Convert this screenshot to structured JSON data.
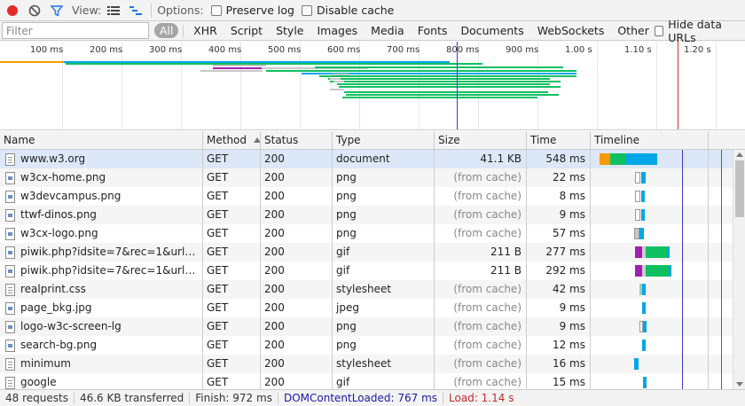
{
  "toolbar": {
    "view_label": "View:",
    "options_label": "Options:",
    "preserve_log_label": "Preserve log",
    "disable_cache_label": "Disable cache"
  },
  "filterbar": {
    "placeholder": "Filter",
    "all_label": "All",
    "types": [
      "XHR",
      "Script",
      "Style",
      "Images",
      "Media",
      "Fonts",
      "Documents",
      "WebSockets",
      "Other"
    ],
    "hide_data_urls_label": "Hide data URLs"
  },
  "overview": {
    "ticks": [
      "100 ms",
      "200 ms",
      "300 ms",
      "400 ms",
      "500 ms",
      "600 ms",
      "700 ms",
      "800 ms",
      "900 ms",
      "1.00 s",
      "1.10 s",
      "1.20 s"
    ]
  },
  "table": {
    "headers": {
      "name": "Name",
      "method": "Method",
      "status": "Status",
      "type": "Type",
      "size": "Size",
      "time": "Time",
      "timeline": "Timeline"
    },
    "rows": [
      {
        "name": "www.w3.org",
        "icon": "doc",
        "method": "GET",
        "status": "200",
        "type": "document",
        "size": "41.1 KB",
        "time": "548 ms",
        "cached": false
      },
      {
        "name": "w3cx-home.png",
        "icon": "img",
        "method": "GET",
        "status": "200",
        "type": "png",
        "size": "(from cache)",
        "time": "22 ms",
        "cached": true
      },
      {
        "name": "w3devcampus.png",
        "icon": "img",
        "method": "GET",
        "status": "200",
        "type": "png",
        "size": "(from cache)",
        "time": "8 ms",
        "cached": true
      },
      {
        "name": "ttwf-dinos.png",
        "icon": "img",
        "method": "GET",
        "status": "200",
        "type": "png",
        "size": "(from cache)",
        "time": "9 ms",
        "cached": true
      },
      {
        "name": "w3cx-logo.png",
        "icon": "img",
        "method": "GET",
        "status": "200",
        "type": "png",
        "size": "(from cache)",
        "time": "57 ms",
        "cached": true
      },
      {
        "name": "piwik.php?idsite=7&rec=1&url=http%...",
        "icon": "img",
        "method": "GET",
        "status": "200",
        "type": "gif",
        "size": "211 B",
        "time": "277 ms",
        "cached": false
      },
      {
        "name": "piwik.php?idsite=7&rec=1&url=http%...",
        "icon": "img",
        "method": "GET",
        "status": "200",
        "type": "gif",
        "size": "211 B",
        "time": "292 ms",
        "cached": false
      },
      {
        "name": "realprint.css",
        "icon": "doc",
        "method": "GET",
        "status": "200",
        "type": "stylesheet",
        "size": "(from cache)",
        "time": "42 ms",
        "cached": true
      },
      {
        "name": "page_bkg.jpg",
        "icon": "img",
        "method": "GET",
        "status": "200",
        "type": "jpeg",
        "size": "(from cache)",
        "time": "9 ms",
        "cached": true
      },
      {
        "name": "logo-w3c-screen-lg",
        "icon": "img",
        "method": "GET",
        "status": "200",
        "type": "png",
        "size": "(from cache)",
        "time": "9 ms",
        "cached": true
      },
      {
        "name": "search-bg.png",
        "icon": "img",
        "method": "GET",
        "status": "200",
        "type": "png",
        "size": "(from cache)",
        "time": "12 ms",
        "cached": true
      },
      {
        "name": "minimum",
        "icon": "doc",
        "method": "GET",
        "status": "200",
        "type": "stylesheet",
        "size": "(from cache)",
        "time": "16 ms",
        "cached": true
      },
      {
        "name": "google",
        "icon": "doc",
        "method": "GET",
        "status": "200",
        "type": "gif",
        "size": "(from cache)",
        "time": "15 ms",
        "cached": true
      }
    ]
  },
  "statusbar": {
    "requests": "48 requests",
    "transferred": "46.6 KB transferred",
    "finish": "Finish: 972 ms",
    "dcl": "DOMContentLoaded: 767 ms",
    "load": "Load: 1.14 s"
  },
  "colors": {
    "record": "#e22a2a",
    "dcl_line": "#3b39c8",
    "load_line": "#d32f2f",
    "dcl_text": "#1a1aa6",
    "load_text": "#c62828",
    "waiting": "#00a6e8",
    "download": "#10c060",
    "connect": "#f59a00",
    "stalled": "#a020b0"
  }
}
